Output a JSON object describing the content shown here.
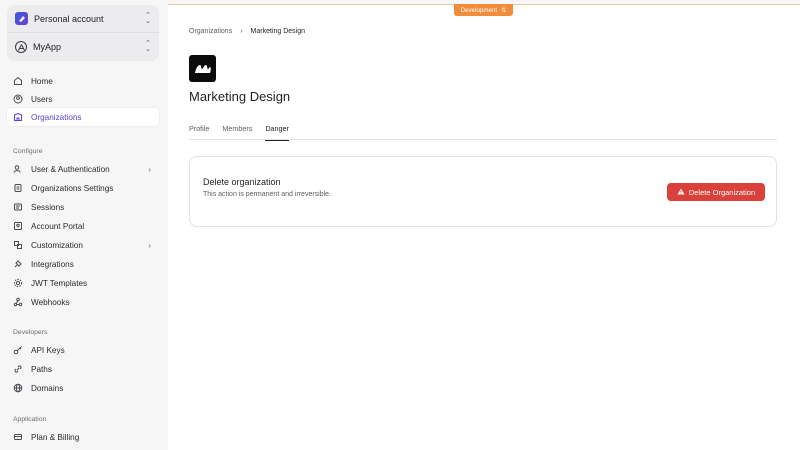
{
  "sidebar": {
    "account": {
      "label": "Personal account"
    },
    "app": {
      "label": "MyApp"
    },
    "items": [
      {
        "label": "Home",
        "icon": "home-icon"
      },
      {
        "label": "Users",
        "icon": "user-circle-icon"
      },
      {
        "label": "Organizations",
        "icon": "building-icon",
        "active": true
      }
    ],
    "configure": {
      "title": "Configure",
      "items": [
        {
          "label": "User & Authentication",
          "icon": "user-auth-icon",
          "expandable": true
        },
        {
          "label": "Organizations Settings",
          "icon": "clipboard-icon"
        },
        {
          "label": "Sessions",
          "icon": "sessions-icon"
        },
        {
          "label": "Account Portal",
          "icon": "portal-icon"
        },
        {
          "label": "Customization",
          "icon": "customization-icon",
          "expandable": true
        },
        {
          "label": "Integrations",
          "icon": "plug-icon"
        },
        {
          "label": "JWT Templates",
          "icon": "gear-icon"
        },
        {
          "label": "Webhooks",
          "icon": "webhook-icon"
        }
      ]
    },
    "developers": {
      "title": "Developers",
      "items": [
        {
          "label": "API Keys",
          "icon": "key-icon"
        },
        {
          "label": "Paths",
          "icon": "link-icon"
        },
        {
          "label": "Domains",
          "icon": "globe-icon"
        }
      ]
    },
    "application": {
      "title": "Application",
      "items": [
        {
          "label": "Plan & Billing",
          "icon": "billing-icon"
        }
      ]
    }
  },
  "env_badge": "Development",
  "breadcrumb": {
    "parent": "Organizations",
    "current": "Marketing Design"
  },
  "org": {
    "name": "Marketing Design"
  },
  "tabs": [
    {
      "label": "Profile"
    },
    {
      "label": "Members"
    },
    {
      "label": "Danger",
      "active": true
    }
  ],
  "danger": {
    "title": "Delete organization",
    "description": "This action is permanent and irreversible.",
    "button_label": "Delete Organization"
  },
  "colors": {
    "accent": "#5b3fd8",
    "danger": "#d9413a",
    "dev_badge": "#f08c3a"
  }
}
